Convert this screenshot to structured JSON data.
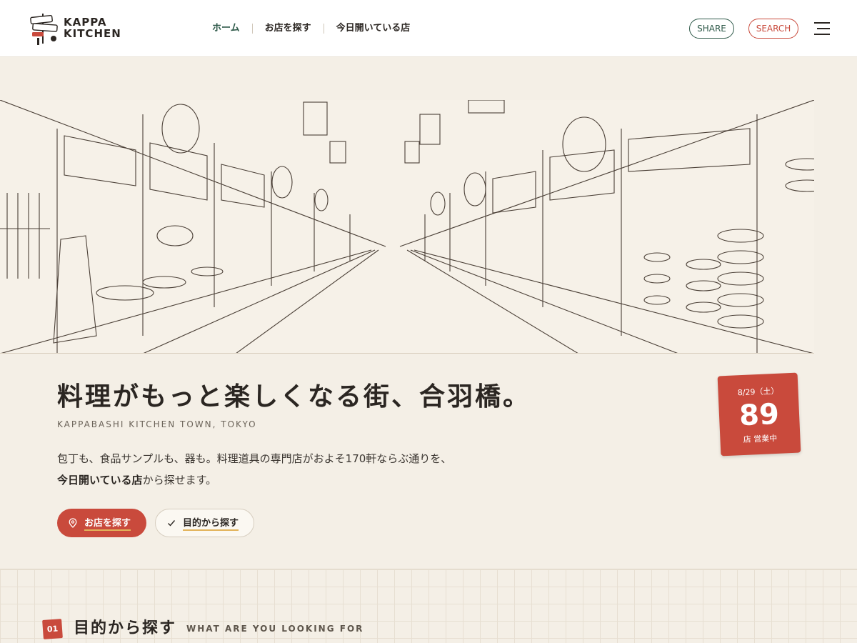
{
  "brand": {
    "line1": "KAPPA",
    "line2": "KITCHEN",
    "sign_top": "KAPPA",
    "sign_mid": "KITCHEN"
  },
  "nav": {
    "items": [
      {
        "label": "ホーム",
        "active": true
      },
      {
        "label": "お店を探す",
        "active": false
      },
      {
        "label": "今日開いている店",
        "active": false
      }
    ]
  },
  "header_actions": {
    "share": "SHARE",
    "search": "SEARCH"
  },
  "hero": {
    "headline": "料理がもっと楽しくなる街、合羽橋。",
    "subhead": "KAPPABASHI KITCHEN TOWN, TOKYO",
    "desc_line1": "包丁も、食品サンプルも、器も。料理道具の専門店がおよそ170軒ならぶ通りを、",
    "desc_bold": "今日開いている店",
    "desc_line2_rest": "から探せます。",
    "btn_primary": "お店を探す",
    "btn_secondary": "目的から探す"
  },
  "open_card": {
    "date": "8/29（土）",
    "count": "89",
    "suffix": "店 営業中"
  },
  "section": {
    "number": "01",
    "title": "目的から探す",
    "subtitle": "WHAT ARE YOU LOOKING FOR"
  },
  "colors": {
    "accent_red": "#c94a3c",
    "accent_green": "#2f5a4a",
    "background": "#f4efe6"
  }
}
